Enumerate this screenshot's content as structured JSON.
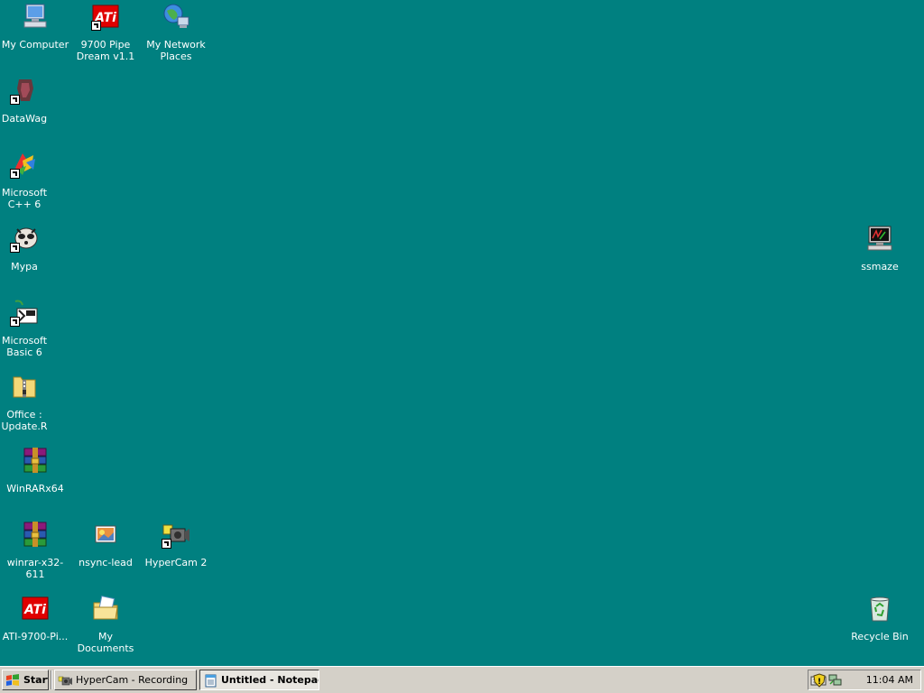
{
  "desktop": {
    "background_color": "#008080",
    "icons": {
      "my_computer": {
        "label": "My Computer",
        "icon": "computer-icon"
      },
      "ati_pipe_dream": {
        "label": "9700 Pipe\nDream v1.1",
        "icon": "ati-logo-icon"
      },
      "my_network_places": {
        "label": "My Network\nPlaces",
        "icon": "network-globe-icon"
      },
      "datawag": {
        "label": "DataWag",
        "icon": "datawag-icon"
      },
      "ms_visual_cpp": {
        "label": "Microsoft\nC++ 6",
        "icon": "visual-studio-icon"
      },
      "mypa": {
        "label": "Mypa",
        "icon": "raccoon-icon"
      },
      "ms_visual_basic": {
        "label": "Microsoft\nBasic 6",
        "icon": "visual-basic-icon"
      },
      "office_update": {
        "label": "Office :\nUpdate.R",
        "icon": "zip-folder-icon"
      },
      "winrar_x64": {
        "label": "WinRARx64",
        "icon": "winrar-icon"
      },
      "winrar_x32": {
        "label": "winrar-x32-611",
        "icon": "winrar-icon"
      },
      "nsync_lead": {
        "label": "nsync-lead",
        "icon": "image-file-icon"
      },
      "hypercam2": {
        "label": "HyperCam 2",
        "icon": "camera-icon"
      },
      "ati_9700": {
        "label": "ATI-9700-Pi...",
        "icon": "ati-logo-icon"
      },
      "my_documents": {
        "label": "My Documents",
        "icon": "documents-folder-icon"
      },
      "ssmaze": {
        "label": "ssmaze",
        "icon": "screensaver-icon"
      },
      "recycle_bin": {
        "label": "Recycle Bin",
        "icon": "recycle-bin-icon"
      }
    }
  },
  "taskbar": {
    "start_label": "Start",
    "tasks": [
      {
        "label": "HyperCam - Recording",
        "icon": "camera-icon"
      },
      {
        "label": "Untitled - Notepad",
        "icon": "notepad-icon"
      }
    ],
    "clock": "11:04 AM",
    "tray_icons": [
      "keyboard-icon",
      "shield-icon",
      "network-icon"
    ]
  }
}
